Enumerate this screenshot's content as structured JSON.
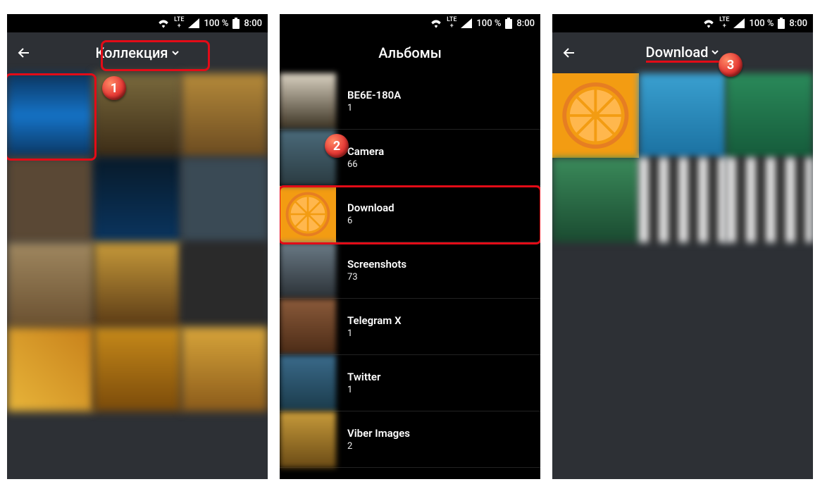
{
  "status": {
    "lte_top": "LTE",
    "lte_bot": "+",
    "battery_pct": "100 %",
    "time": "8:00"
  },
  "phone1": {
    "title": "Коллекция"
  },
  "phone2": {
    "title": "Альбомы",
    "albums": [
      {
        "name": "BE6E-180A",
        "count": "1"
      },
      {
        "name": "Camera",
        "count": "66"
      },
      {
        "name": "Download",
        "count": "6"
      },
      {
        "name": "Screenshots",
        "count": "73"
      },
      {
        "name": "Telegram X",
        "count": "1"
      },
      {
        "name": "Twitter",
        "count": "1"
      },
      {
        "name": "Viber Images",
        "count": "2"
      }
    ]
  },
  "phone3": {
    "title": "Download"
  },
  "callouts": {
    "n1": "1",
    "n2": "2",
    "n3": "3"
  }
}
